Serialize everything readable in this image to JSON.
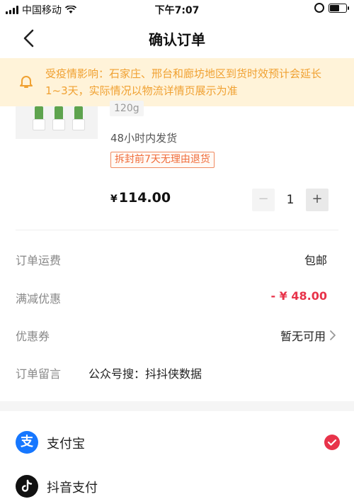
{
  "status_bar": {
    "carrier": "中国移动",
    "time": "下午7:07"
  },
  "nav": {
    "title": "确认订单"
  },
  "notice": {
    "text": "受疫情影响：石家庄、邢台和廊坊地区到货时效预计会延长1~3天，实际情况以物流详情页展示为准"
  },
  "product": {
    "spec": "120g",
    "shipping": "48小时内发货",
    "return_policy": "拆封前7天无理由退货",
    "currency": "¥",
    "price": "114.00",
    "quantity": "1",
    "minus_label": "−",
    "plus_label": "+"
  },
  "rows": {
    "shipping_fee": {
      "label": "订单运费",
      "value": "包邮"
    },
    "discount": {
      "label": "满减优惠",
      "value": "- ¥ 48.00"
    },
    "coupon": {
      "label": "优惠券",
      "value": "暂无可用"
    },
    "note": {
      "label": "订单留言",
      "value": "公众号搜：抖抖侠数据"
    }
  },
  "payment": {
    "methods": [
      {
        "label": "支付宝",
        "icon": "alipay-icon",
        "selected": true
      },
      {
        "label": "抖音支付",
        "icon": "douyin-pay-icon",
        "selected": false
      }
    ]
  },
  "colors": {
    "accent_red": "#e8334a",
    "notice_bg": "#fff3d9",
    "notice_text": "#f0a132",
    "alipay_blue": "#1677ff"
  }
}
